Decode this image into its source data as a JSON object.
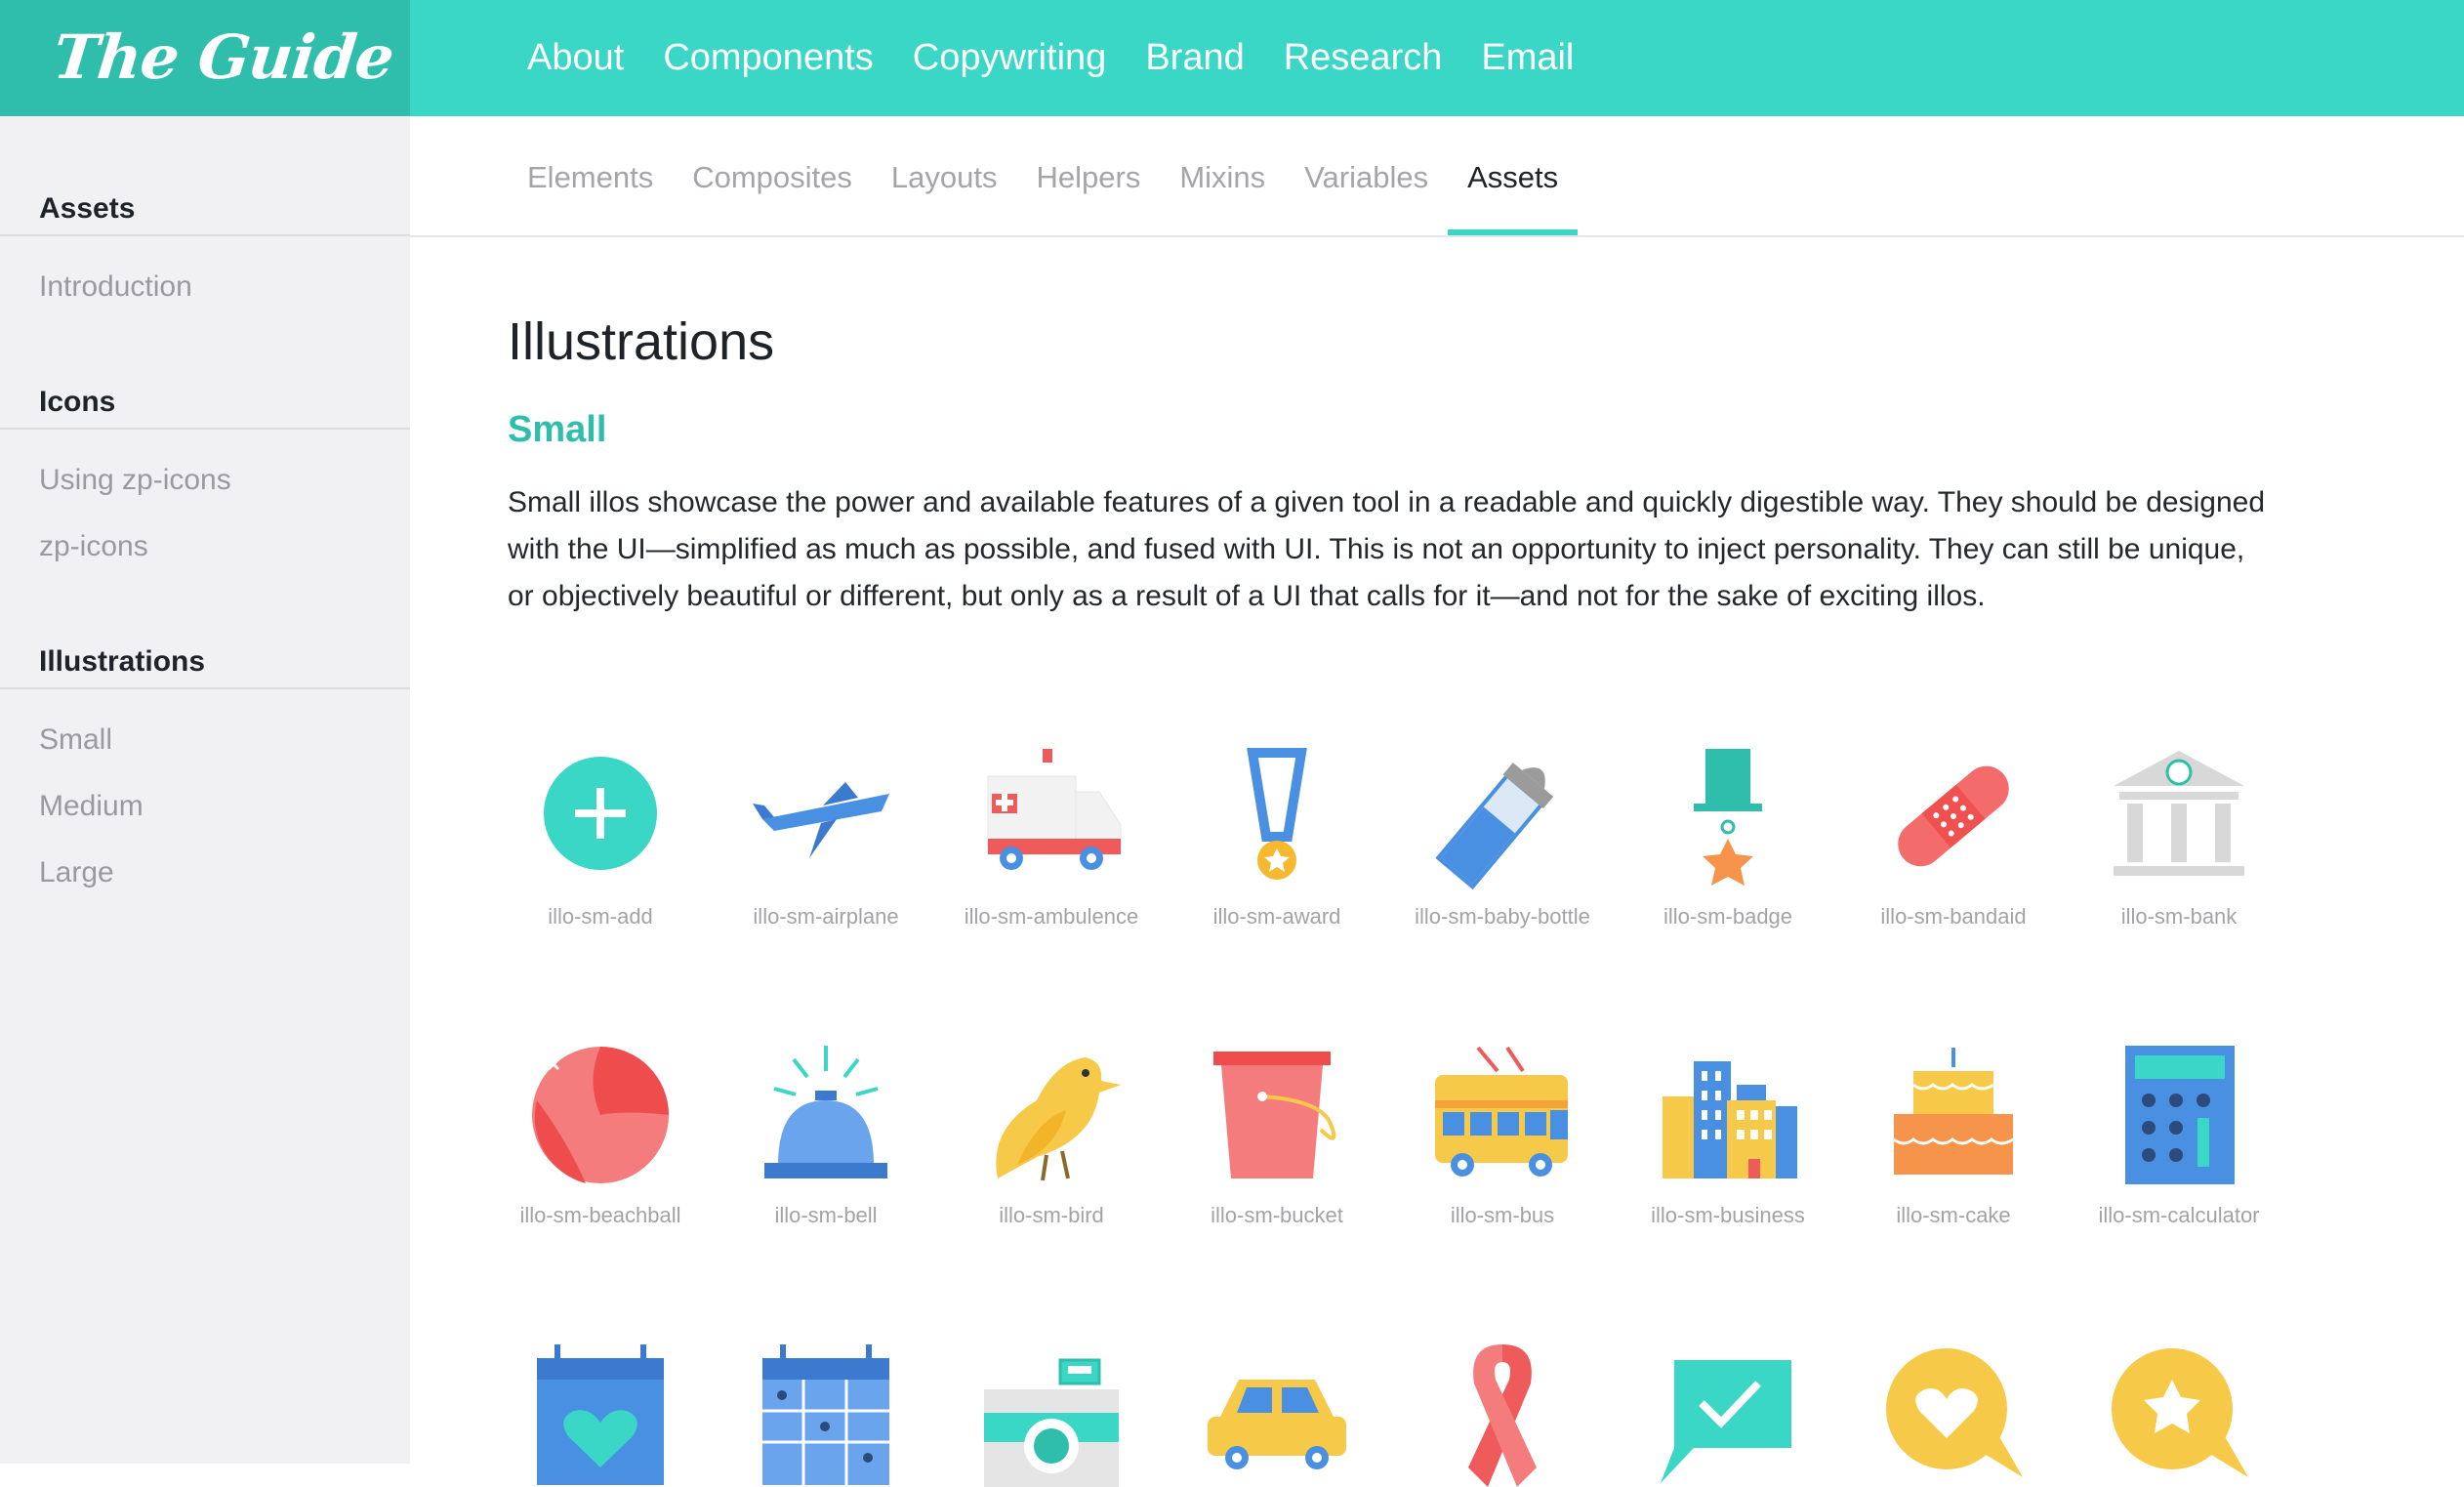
{
  "app": {
    "logo_text": "The Guide",
    "brand_color": "#3ad6c6",
    "accent_dark": "#2fbeac"
  },
  "main_nav": [
    "About",
    "Components",
    "Copywriting",
    "Brand",
    "Research",
    "Email"
  ],
  "sub_nav": {
    "tabs": [
      "Elements",
      "Composites",
      "Layouts",
      "Helpers",
      "Mixins",
      "Variables",
      "Assets"
    ],
    "active": "Assets"
  },
  "sidebar": {
    "sections": [
      {
        "heading": "Assets",
        "items": [
          "Introduction"
        ]
      },
      {
        "heading": "Icons",
        "items": [
          "Using zp-icons",
          "zp-icons"
        ]
      },
      {
        "heading": "Illustrations",
        "items": [
          "Small",
          "Medium",
          "Large"
        ]
      }
    ]
  },
  "page": {
    "title": "Illustrations",
    "subtitle": "Small",
    "description": "Small illos showcase the power and available features of a given tool in a readable and quickly digestible way. They should be designed with the UI—simplified as much as possible, and fused with UI. This is not an opportunity to inject personality. They can still be unique, or objectively beautiful or different, but only as a result of a UI that calls for it—and not for the sake of exciting illos."
  },
  "illustrations": [
    {
      "label": "illo-sm-add",
      "icon": "add-icon"
    },
    {
      "label": "illo-sm-airplane",
      "icon": "airplane-icon"
    },
    {
      "label": "illo-sm-ambulence",
      "icon": "ambulance-icon"
    },
    {
      "label": "illo-sm-award",
      "icon": "award-icon"
    },
    {
      "label": "illo-sm-baby-bottle",
      "icon": "baby-bottle-icon"
    },
    {
      "label": "illo-sm-badge",
      "icon": "badge-icon"
    },
    {
      "label": "illo-sm-bandaid",
      "icon": "bandaid-icon"
    },
    {
      "label": "illo-sm-bank",
      "icon": "bank-icon"
    },
    {
      "label": "illo-sm-beachball",
      "icon": "beachball-icon"
    },
    {
      "label": "illo-sm-bell",
      "icon": "bell-icon"
    },
    {
      "label": "illo-sm-bird",
      "icon": "bird-icon"
    },
    {
      "label": "illo-sm-bucket",
      "icon": "bucket-icon"
    },
    {
      "label": "illo-sm-bus",
      "icon": "bus-icon"
    },
    {
      "label": "illo-sm-business",
      "icon": "business-icon"
    },
    {
      "label": "illo-sm-cake",
      "icon": "cake-icon"
    },
    {
      "label": "illo-sm-calculator",
      "icon": "calculator-icon"
    },
    {
      "label": "",
      "icon": "calendar-heart-icon"
    },
    {
      "label": "",
      "icon": "calendar-grid-icon"
    },
    {
      "label": "",
      "icon": "camera-icon"
    },
    {
      "label": "",
      "icon": "car-icon"
    },
    {
      "label": "",
      "icon": "ribbon-icon"
    },
    {
      "label": "",
      "icon": "chat-check-icon"
    },
    {
      "label": "",
      "icon": "chat-heart-icon"
    },
    {
      "label": "",
      "icon": "chat-star-icon"
    }
  ]
}
